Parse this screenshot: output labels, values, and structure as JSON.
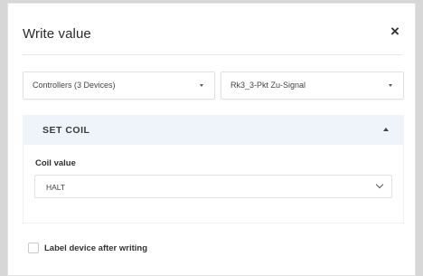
{
  "dialog": {
    "title": "Write value",
    "close_label": "×"
  },
  "filters": {
    "target": "Controllers (3 Devices)",
    "datapoint": "Rk3_3-Pkt Zu-Signal"
  },
  "section": {
    "title": "SET COIL",
    "expanded": true,
    "field_label": "Coil value",
    "field_value": "HALT"
  },
  "options": {
    "label_device_text": "Label device after writing",
    "label_device_checked": false
  },
  "icons": {
    "close": "close-icon",
    "dropdown": "caret-down-icon",
    "collapse": "caret-up-icon",
    "select": "chevron-down-icon"
  }
}
